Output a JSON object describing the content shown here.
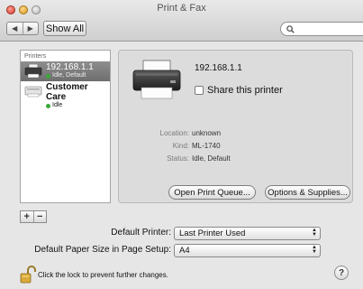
{
  "window": {
    "title": "Print & Fax"
  },
  "toolbar": {
    "back_icon": "triangle-left-icon",
    "forward_icon": "triangle-right-icon",
    "show_all_label": "Show All",
    "search_placeholder": ""
  },
  "sidebar": {
    "header": "Printers",
    "printers": [
      {
        "name": "192.168.1.1",
        "status": "Idle, Default",
        "selected": true
      },
      {
        "name": "Customer Care",
        "status": "Idle",
        "selected": false
      }
    ]
  },
  "list_controls": {
    "add_label": "+",
    "remove_label": "−"
  },
  "details": {
    "printer_name": "192.168.1.1",
    "share_label": "Share this printer",
    "share_checked": false,
    "location_label": "Location:",
    "location_value": "unknown",
    "kind_label": "Kind:",
    "kind_value": "ML-1740",
    "status_label": "Status:",
    "status_value": "Idle, Default",
    "open_queue_label": "Open Print Queue...",
    "options_label": "Options & Supplies..."
  },
  "form": {
    "default_printer_label": "Default Printer:",
    "default_printer_value": "Last Printer Used",
    "paper_size_label": "Default Paper Size in Page Setup:",
    "paper_size_value": "A4"
  },
  "footer": {
    "lock_text": "Click the lock to prevent further changes.",
    "help_label": "?"
  },
  "colors": {
    "selection": "#7a7a7a",
    "status_dot": "#3aa83a",
    "window_bg": "#e6e6e6"
  }
}
